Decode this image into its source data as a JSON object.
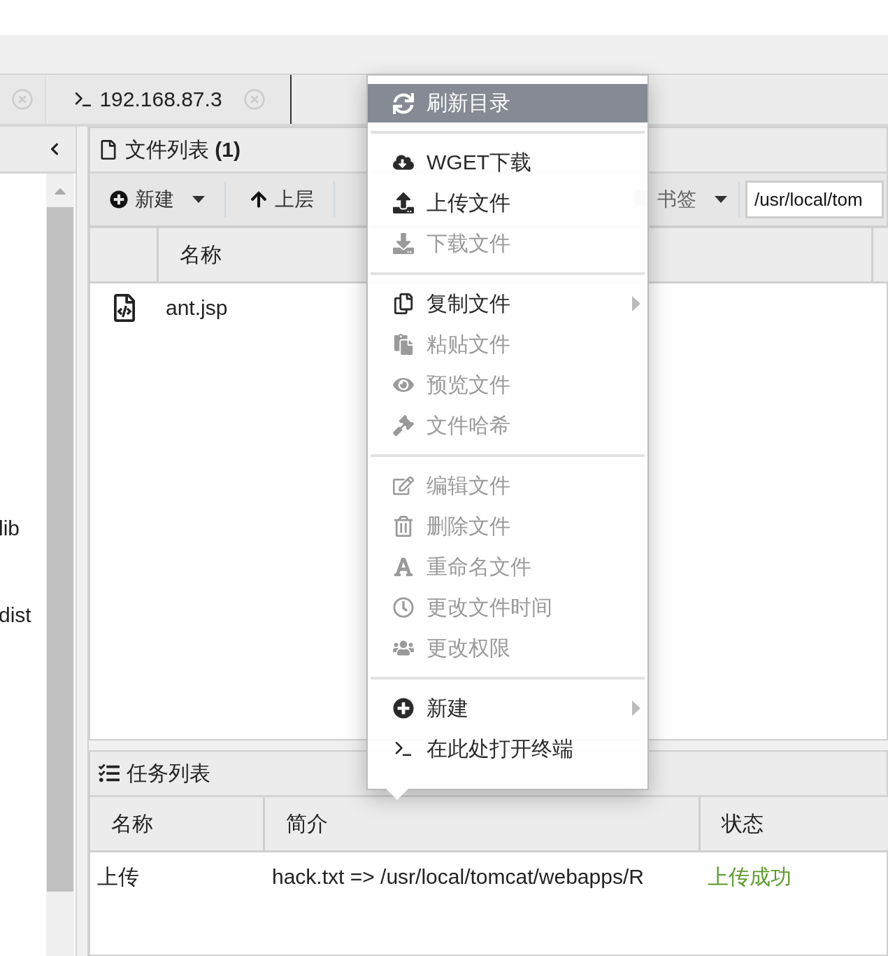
{
  "tabs": [
    {
      "kind": "blank"
    },
    {
      "kind": "terminal",
      "label": "192.168.87.3"
    }
  ],
  "tree": {
    "items": [
      {
        "label": "lib"
      },
      {
        "label": "dist"
      }
    ]
  },
  "file_panel": {
    "title": "文件列表",
    "count": "(1)",
    "toolbar": [
      {
        "label": "新建",
        "dropdown": true
      },
      {
        "label": "上层",
        "dropdown": false
      },
      {
        "label": "书签",
        "dropdown": true
      }
    ],
    "path": "/usr/local/tom",
    "columns": [
      "名称"
    ],
    "rows": [
      {
        "name": "ant.jsp"
      }
    ]
  },
  "context_menu": {
    "groups": [
      [
        {
          "label": "刷新目录",
          "selected": true,
          "disabled": false,
          "submenu": false
        }
      ],
      [
        {
          "label": "WGET下载",
          "selected": false,
          "disabled": false,
          "submenu": false
        },
        {
          "label": "上传文件",
          "selected": false,
          "disabled": false,
          "submenu": false
        },
        {
          "label": "下载文件",
          "selected": false,
          "disabled": true,
          "submenu": false
        }
      ],
      [
        {
          "label": "复制文件",
          "selected": false,
          "disabled": false,
          "submenu": true
        },
        {
          "label": "粘贴文件",
          "selected": false,
          "disabled": true,
          "submenu": false
        },
        {
          "label": "预览文件",
          "selected": false,
          "disabled": true,
          "submenu": false
        },
        {
          "label": "文件哈希",
          "selected": false,
          "disabled": true,
          "submenu": false
        }
      ],
      [
        {
          "label": "编辑文件",
          "selected": false,
          "disabled": true,
          "submenu": false
        },
        {
          "label": "删除文件",
          "selected": false,
          "disabled": true,
          "submenu": false
        },
        {
          "label": "重命名文件",
          "selected": false,
          "disabled": true,
          "submenu": false
        },
        {
          "label": "更改文件时间",
          "selected": false,
          "disabled": true,
          "submenu": false
        },
        {
          "label": "更改权限",
          "selected": false,
          "disabled": true,
          "submenu": false
        }
      ],
      [
        {
          "label": "新建",
          "selected": false,
          "disabled": false,
          "submenu": true
        },
        {
          "label": "在此处打开终端",
          "selected": false,
          "disabled": false,
          "submenu": false
        }
      ]
    ]
  },
  "task_panel": {
    "title": "任务列表",
    "columns": [
      "名称",
      "简介",
      "状态"
    ],
    "rows": [
      {
        "name": "上传",
        "description": "hack.txt => /usr/local/tomcat/webapps/R",
        "status": "上传成功",
        "color": "#5b9a2c"
      }
    ]
  }
}
